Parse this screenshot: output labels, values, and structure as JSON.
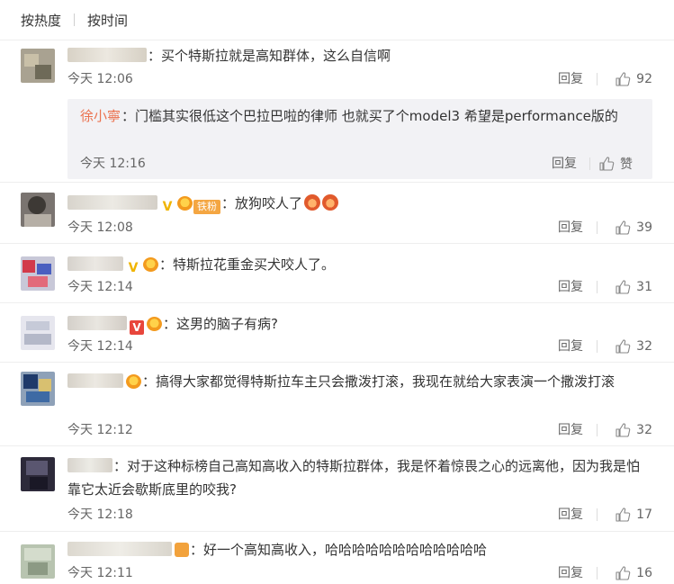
{
  "sort": {
    "hot": "按热度",
    "time": "按时间"
  },
  "like_glyph": "thumb-up-icon",
  "comments": [
    {
      "text": "买个特斯拉就是高知群体，这么自信啊",
      "time": "今天 12:06",
      "reply": "回复",
      "likes": "92",
      "sub": {
        "user": "徐小寧",
        "text": "门槛其实很低这个巴拉巴啦的律师 也就买了个model3 希望是performance版的",
        "time": "今天 12:16",
        "reply": "回复",
        "likes": "赞"
      }
    },
    {
      "fan": "铁粉",
      "text": "放狗咬人了",
      "time": "今天 12:08",
      "reply": "回复",
      "likes": "39"
    },
    {
      "text": "特斯拉花重金买犬咬人了。",
      "time": "今天 12:14",
      "reply": "回复",
      "likes": "31"
    },
    {
      "text": "这男的脑子有病?",
      "time": "今天 12:14",
      "reply": "回复",
      "likes": "32"
    },
    {
      "text": "搞得大家都觉得特斯拉车主只会撒泼打滚，我现在就给大家表演一个撒泼打滚",
      "time": "今天 12:12",
      "reply": "回复",
      "likes": "32"
    },
    {
      "text": "对于这种标榜自己高知高收入的特斯拉群体，我是怀着惊畏之心的远离他，因为我是怕靠它太近会歇斯底里的咬我?",
      "time": "今天 12:18",
      "reply": "回复",
      "likes": "17"
    },
    {
      "text": "好一个高知高收入，哈哈哈哈哈哈哈哈哈哈哈哈",
      "time": "今天 12:11",
      "reply": "回复",
      "likes": "16"
    }
  ]
}
